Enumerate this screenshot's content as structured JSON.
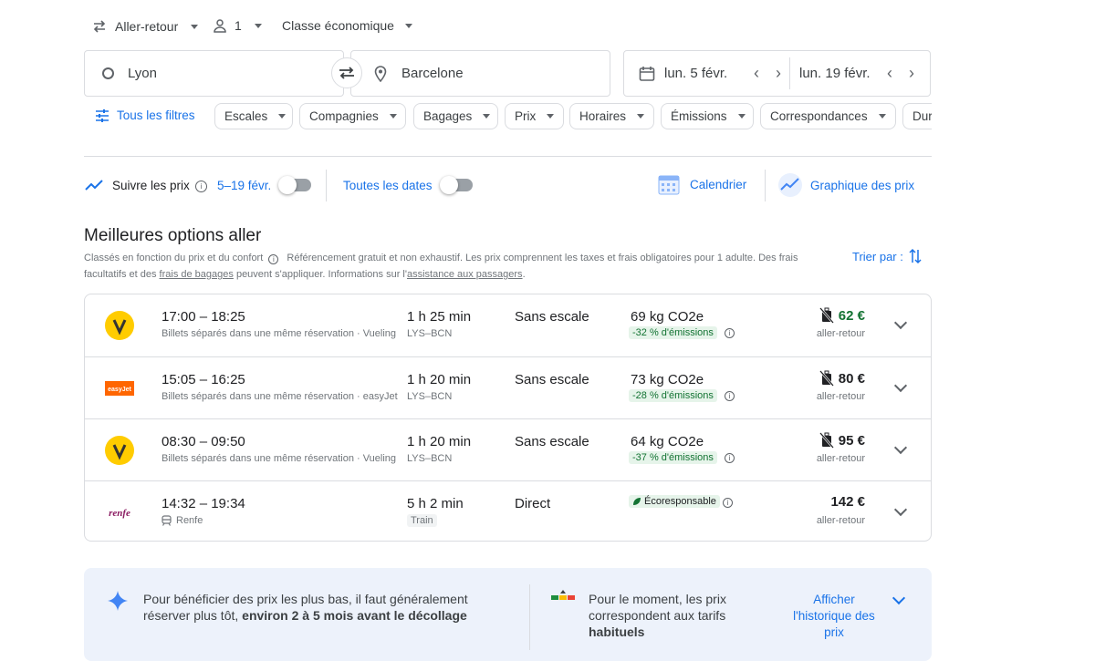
{
  "trip_options": {
    "trip_type": "Aller-retour",
    "passengers": "1",
    "cabin_class": "Classe économique"
  },
  "search": {
    "origin": "Lyon",
    "destination": "Barcelone",
    "depart_date": "lun. 5 févr.",
    "return_date": "lun. 19 févr."
  },
  "filters": {
    "all_filters": "Tous les filtres",
    "chips": [
      "Escales",
      "Compagnies",
      "Bagages",
      "Prix",
      "Horaires",
      "Émissions",
      "Correspondances",
      "Dur"
    ]
  },
  "tracking": {
    "track_prices": "Suivre les prix",
    "date_range": "5–19 févr.",
    "all_dates": "Toutes les dates",
    "calendar": "Calendrier",
    "price_graph": "Graphique des prix"
  },
  "results": {
    "title": "Meilleures options aller",
    "disclaimer_1": "Classés en fonction du prix et du confort",
    "disclaimer_2": "Référencement gratuit et non exhaustif. Les prix comprennent les taxes et frais obligatoires pour 1 adulte. Des frais",
    "disclaimer_3a": "facultatifs et des ",
    "disclaimer_link1": "frais de bagages",
    "disclaimer_3b": " peuvent s'appliquer. Informations sur l'",
    "disclaimer_link2": "assistance aux passagers",
    "disclaimer_3c": ".",
    "sort_label": "Trier par :",
    "flights": [
      {
        "logo": "vueling-logo",
        "times": "17:00 – 18:25",
        "subtitle": "Billets séparés dans une même réservation · Vueling",
        "duration": "1 h 25 min",
        "route": "LYS–BCN",
        "stops": "Sans escale",
        "co2": "69 kg CO2e",
        "emissions_badge": "-32 % d'émissions",
        "price": "62 €",
        "price_color": "#137333",
        "price_type": "aller-retour"
      },
      {
        "logo": "easyjet-logo",
        "times": "15:05 – 16:25",
        "subtitle": "Billets séparés dans une même réservation · easyJet",
        "duration": "1 h 20 min",
        "route": "LYS–BCN",
        "stops": "Sans escale",
        "co2": "73 kg CO2e",
        "emissions_badge": "-28 % d'émissions",
        "price": "80 €",
        "price_color": "#202124",
        "price_type": "aller-retour"
      },
      {
        "logo": "vueling-logo",
        "times": "08:30 – 09:50",
        "subtitle": "Billets séparés dans une même réservation · Vueling",
        "duration": "1 h 20 min",
        "route": "LYS–BCN",
        "stops": "Sans escale",
        "co2": "64 kg CO2e",
        "emissions_badge": "-37 % d'émissions",
        "price": "95 €",
        "price_color": "#202124",
        "price_type": "aller-retour"
      },
      {
        "logo": "renfe-logo",
        "times": "14:32 – 19:34",
        "subtitle": "Renfe",
        "duration": "5 h 2 min",
        "route": "Train",
        "stops": "Direct",
        "co2": "",
        "emissions_badge": "Écoresponsable",
        "price": "142 €",
        "price_color": "#202124",
        "price_type": "aller-retour"
      }
    ]
  },
  "insights": {
    "tip_text_1": "Pour bénéficier des prix les plus bas, il faut généralement",
    "tip_text_2": "réserver plus tôt, ",
    "tip_text_bold": "environ 2 à 5 mois avant le décollage",
    "price_text_1": "Pour le moment, les prix",
    "price_text_2": "correspondent aux tarifs",
    "price_text_bold": "habituels",
    "history_link": "Afficher l'historique des prix"
  },
  "colors": {
    "accent": "#1a73e8",
    "green": "#137333",
    "vueling_yellow": "#ffcc00",
    "easyjet_orange": "#ff6600",
    "renfe_purple": "#8a1b61"
  }
}
